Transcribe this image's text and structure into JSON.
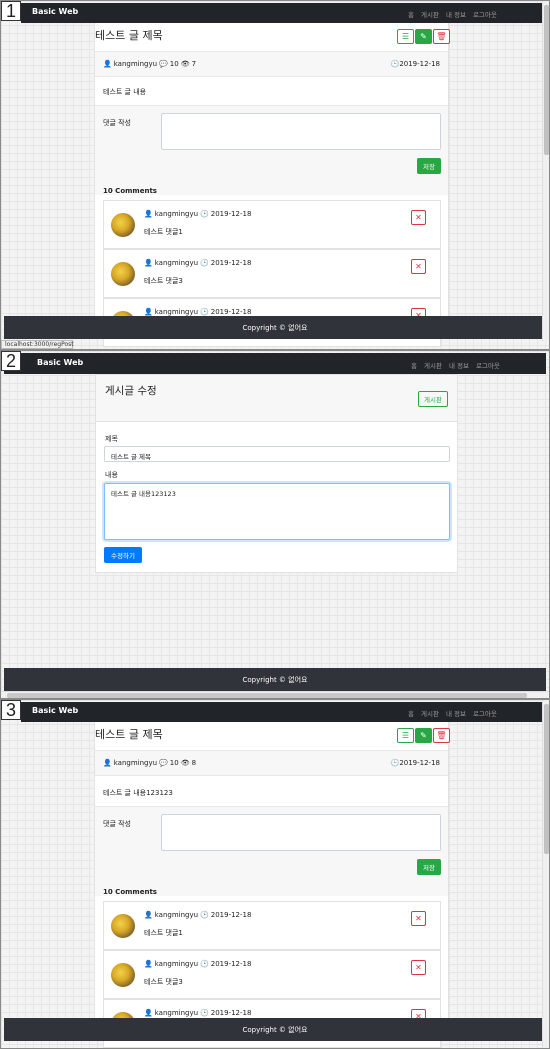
{
  "steps": [
    "1",
    "2",
    "3"
  ],
  "navbar": {
    "brand": "Basic Web",
    "links": [
      "홈",
      "게시판",
      "내 정보",
      "로그아웃"
    ]
  },
  "icons": {
    "list": "list-icon",
    "edit": "edit-icon",
    "delete": "trash-icon",
    "user": "user-icon",
    "comment": "comment-icon",
    "views": "eye-icon",
    "clock": "clock-icon",
    "remove": "times-icon"
  },
  "colors": {
    "navbar": "#212529",
    "footer": "#30343a",
    "success": "#28a745",
    "danger": "#dc3545",
    "primary": "#007bff"
  },
  "footer": {
    "text": "Copyright © 없어요"
  },
  "status_bar": {
    "url": "localhost:3000/regPost"
  },
  "post_view_1": {
    "title": "테스트 글 제목",
    "author": "kangmingyu",
    "comment_count": "10",
    "views": "7",
    "date": "2019-12-18",
    "content": "테스트 글 내용",
    "comment_form": {
      "label": "댓글 작성",
      "save_label": "저장"
    },
    "comments_header": "10 Comments",
    "comments": [
      {
        "author": "kangmingyu",
        "date": "2019-12-18",
        "text": "테스트 댓글1"
      },
      {
        "author": "kangmingyu",
        "date": "2019-12-18",
        "text": "테스트 댓글3"
      },
      {
        "author": "kangmingyu",
        "date": "2019-12-18",
        "text": ""
      }
    ]
  },
  "edit_form": {
    "heading": "게시글 수정",
    "board_button": "게시판",
    "title_label": "제목",
    "title_value": "테스트 글 제목",
    "content_label": "내용",
    "content_value": "테스트 글 내용123123",
    "submit_label": "수정하기"
  },
  "post_view_3": {
    "title": "테스트 글 제목",
    "author": "kangmingyu",
    "comment_count": "10",
    "views": "8",
    "date": "2019-12-18",
    "content": "테스트 글 내용123123",
    "comment_form": {
      "label": "댓글 작성",
      "save_label": "저장"
    },
    "comments_header": "10 Comments",
    "comments": [
      {
        "author": "kangmingyu",
        "date": "2019-12-18",
        "text": "테스트 댓글1"
      },
      {
        "author": "kangmingyu",
        "date": "2019-12-18",
        "text": "테스트 댓글3"
      },
      {
        "author": "kangmingyu",
        "date": "2019-12-18",
        "text": ""
      }
    ]
  }
}
